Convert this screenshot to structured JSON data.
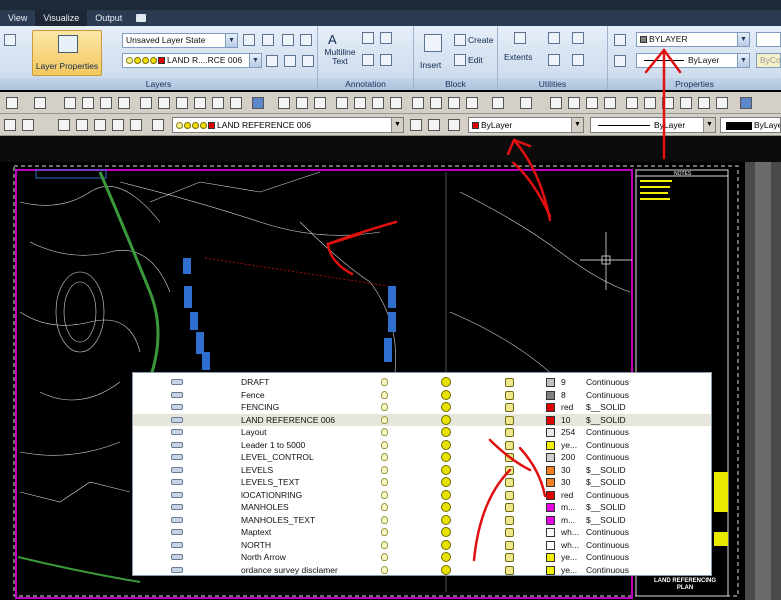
{
  "tabs": [
    "View",
    "Visualize",
    "Output"
  ],
  "layers_panel": {
    "layer_properties_label": "Layer Properties",
    "layer_state_value": "Unsaved Layer State",
    "current_layer_value": "LAND R....RCE 006",
    "panel_label": "Layers"
  },
  "annotation_panel": {
    "multiline_text_label": "Multiline\nText",
    "panel_label": "Annotation"
  },
  "block_panel": {
    "insert_label": "Insert",
    "create_label": "Create",
    "edit_label": "Edit",
    "panel_label": "Block"
  },
  "utilities_panel": {
    "extents_label": "Extents",
    "panel_label": "Utilities"
  },
  "properties_panel": {
    "color_value": "BYLAYER",
    "linetype_value": "ByLayer",
    "lineweight_value": "ByCol",
    "panel_label": "Properties"
  },
  "layers_toolbar": {
    "current_layer": "LAND REFERENCE 006",
    "color": "ByLayer",
    "linetype": "ByLayer",
    "lineweight": "ByLayer"
  },
  "layer_list": [
    {
      "name": "DRAFT",
      "color_hex": "#c0c0c0",
      "color": "9",
      "linetype": "Continuous"
    },
    {
      "name": "Fence",
      "color_hex": "#808080",
      "color": "8",
      "linetype": "Continuous"
    },
    {
      "name": "FENCING",
      "color_hex": "#e00000",
      "color": "red",
      "linetype": "$__SOLID"
    },
    {
      "name": "LAND REFERENCE 006",
      "color_hex": "#e00000",
      "color": "10",
      "linetype": "$__SOLID"
    },
    {
      "name": "Layout",
      "color_hex": "#e8e8e8",
      "color": "254",
      "linetype": "Continuous"
    },
    {
      "name": "Leader 1 to 5000",
      "color_hex": "#f0f000",
      "color": "ye...",
      "linetype": "Continuous"
    },
    {
      "name": "LEVEL_CONTROL",
      "color_hex": "#cfcfcf",
      "color": "200",
      "linetype": "Continuous"
    },
    {
      "name": "LEVELS",
      "color_hex": "#f08020",
      "color": "30",
      "linetype": "$__SOLID"
    },
    {
      "name": "LEVELS_TEXT",
      "color_hex": "#f08020",
      "color": "30",
      "linetype": "$__SOLID"
    },
    {
      "name": "lOCATIONRING",
      "color_hex": "#e00000",
      "color": "red",
      "linetype": "Continuous"
    },
    {
      "name": "MANHOLES",
      "color_hex": "#e000e0",
      "color": "m...",
      "linetype": "$__SOLID"
    },
    {
      "name": "MANHOLES_TEXT",
      "color_hex": "#e000e0",
      "color": "m...",
      "linetype": "$__SOLID"
    },
    {
      "name": "Maptext",
      "color_hex": "#ffffff",
      "color": "wh...",
      "linetype": "Continuous"
    },
    {
      "name": "NORTH",
      "color_hex": "#ffffff",
      "color": "wh...",
      "linetype": "Continuous"
    },
    {
      "name": "North Arrow",
      "color_hex": "#f0f000",
      "color": "ye...",
      "linetype": "Continuous"
    },
    {
      "name": "ordance survey disclamer",
      "color_hex": "#f0f000",
      "color": "ye...",
      "linetype": "Continuous"
    }
  ],
  "highlighted_layer_index": 3,
  "drawing": {
    "notes_title": "NOTES",
    "title_block": "LAND REFERENCING\nPLAN"
  },
  "colors": {
    "ribbon": "#c9d8ea",
    "annotation_red": "#e01010",
    "viewport_magenta": "#c000c0",
    "parcel_blue": "#2f6fd0"
  }
}
